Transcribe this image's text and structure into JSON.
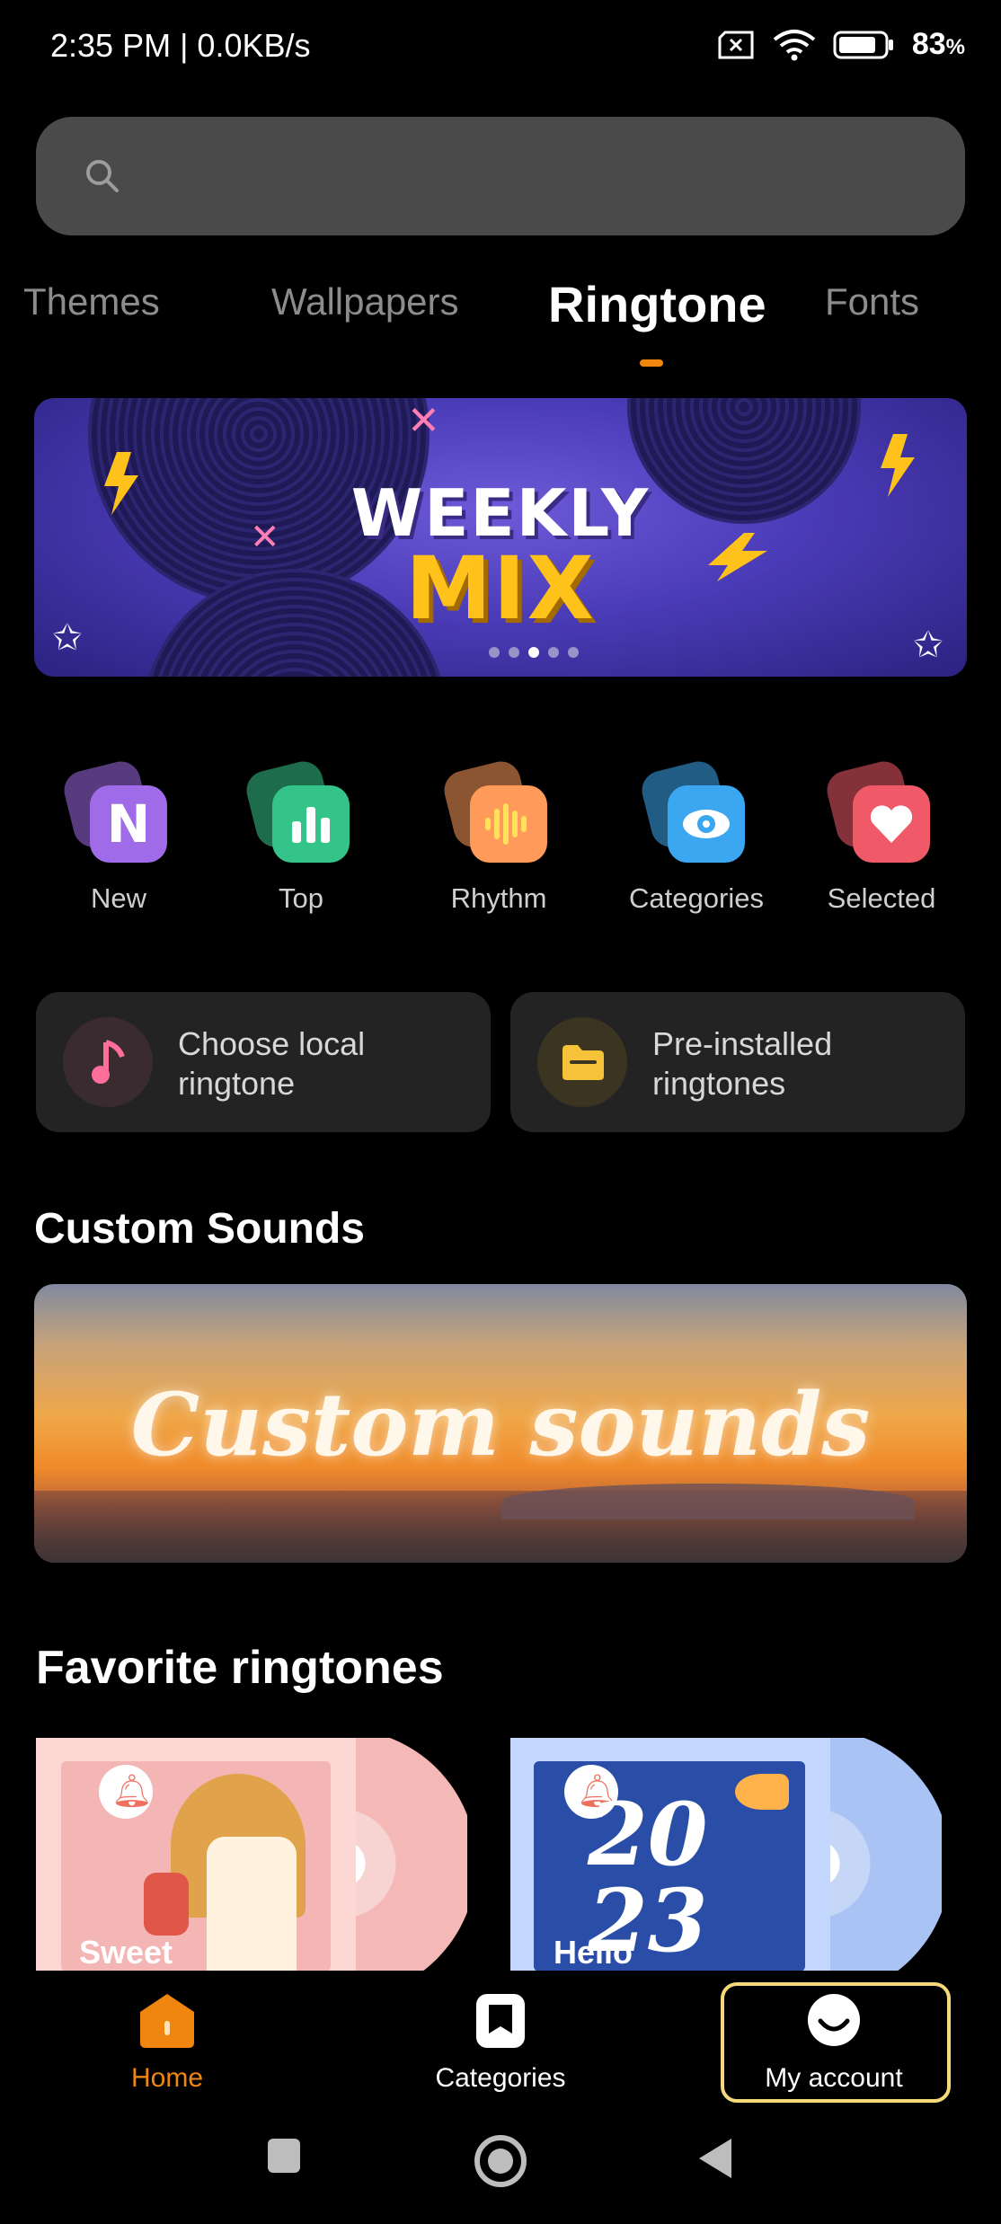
{
  "status_bar": {
    "time_speed": "2:35 PM | 0.0KB/s",
    "battery": "83",
    "battery_unit": "%"
  },
  "search": {
    "placeholder": ""
  },
  "tabs": [
    {
      "label": "Themes"
    },
    {
      "label": "Wallpapers"
    },
    {
      "label": "Ringtone",
      "active": true
    },
    {
      "label": "Fonts"
    }
  ],
  "banner": {
    "line1": "WEEKLY",
    "line2": "MIX",
    "page_count": 5,
    "current_page": 3
  },
  "quick_access": [
    {
      "label": "New",
      "icon": "n-letter-icon",
      "color": "#a06be8"
    },
    {
      "label": "Top",
      "icon": "bar-chart-icon",
      "color": "#34c48a"
    },
    {
      "label": "Rhythm",
      "icon": "waveform-icon",
      "color": "#ff9a5a"
    },
    {
      "label": "Categories",
      "icon": "eye-icon",
      "color": "#3aa7f0"
    },
    {
      "label": "Selected",
      "icon": "heart-icon",
      "color": "#f05a68"
    }
  ],
  "cards": [
    {
      "line1": "Choose local",
      "line2": "ringtone",
      "icon": "music-note-icon"
    },
    {
      "line1": "Pre-installed",
      "line2": "ringtones",
      "icon": "folder-icon"
    }
  ],
  "custom_sounds": {
    "section_title": "Custom Sounds",
    "banner_text": "Custom sounds"
  },
  "favorites": {
    "section_title": "Favorite ringtones",
    "items": [
      {
        "label": "Sweet"
      },
      {
        "label": "Hello",
        "cover_text": "2023"
      }
    ]
  },
  "bottom_nav": [
    {
      "label": "Home",
      "active": true
    },
    {
      "label": "Categories"
    },
    {
      "label": "My account"
    }
  ],
  "colors": {
    "accent": "#f0860f",
    "highlight_border": "#f6d97a"
  }
}
